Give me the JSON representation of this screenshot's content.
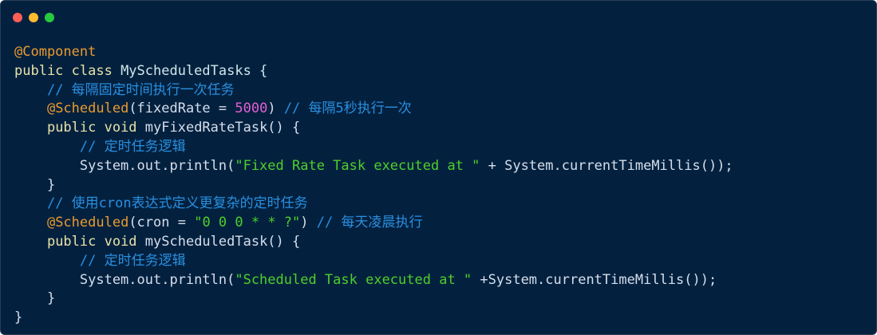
{
  "window": {
    "buttons": {
      "close_color": "#ff5f57",
      "minimize_color": "#febc2e",
      "zoom_color": "#28c840"
    }
  },
  "code": {
    "language": "java",
    "lines": [
      [
        {
          "t": "@Component",
          "k": "ann"
        }
      ],
      [
        {
          "t": "public class ",
          "k": "kw"
        },
        {
          "t": "MyScheduledTasks {",
          "k": "cls"
        }
      ],
      [
        {
          "t": "    ",
          "k": "pl"
        },
        {
          "t": "// 每隔固定时间执行一次任务",
          "k": "cm"
        }
      ],
      [
        {
          "t": "    ",
          "k": "pl"
        },
        {
          "t": "@Scheduled",
          "k": "ann"
        },
        {
          "t": "(fixedRate = ",
          "k": "pl"
        },
        {
          "t": "5000",
          "k": "num"
        },
        {
          "t": ") ",
          "k": "pl"
        },
        {
          "t": "// 每隔5秒执行一次",
          "k": "cm"
        }
      ],
      [
        {
          "t": "    ",
          "k": "pl"
        },
        {
          "t": "public void ",
          "k": "kw"
        },
        {
          "t": "myFixedRateTask() {",
          "k": "pl"
        }
      ],
      [
        {
          "t": "        ",
          "k": "pl"
        },
        {
          "t": "// 定时任务逻辑",
          "k": "cm"
        }
      ],
      [
        {
          "t": "        System.out.println(",
          "k": "pl"
        },
        {
          "t": "\"Fixed Rate Task executed at \"",
          "k": "str"
        },
        {
          "t": " + System.currentTimeMillis());",
          "k": "pl"
        }
      ],
      [
        {
          "t": "    }",
          "k": "pl"
        }
      ],
      [
        {
          "t": "    ",
          "k": "pl"
        },
        {
          "t": "// 使用cron表达式定义更复杂的定时任务",
          "k": "cm"
        }
      ],
      [
        {
          "t": "    ",
          "k": "pl"
        },
        {
          "t": "@Scheduled",
          "k": "ann"
        },
        {
          "t": "(cron = ",
          "k": "pl"
        },
        {
          "t": "\"0 0 0 * * ?\"",
          "k": "str"
        },
        {
          "t": ") ",
          "k": "pl"
        },
        {
          "t": "// 每天凌晨执行",
          "k": "cm"
        }
      ],
      [
        {
          "t": "    ",
          "k": "pl"
        },
        {
          "t": "public void ",
          "k": "kw"
        },
        {
          "t": "myScheduledTask() {",
          "k": "pl"
        }
      ],
      [
        {
          "t": "        ",
          "k": "pl"
        },
        {
          "t": "// 定时任务逻辑",
          "k": "cm"
        }
      ],
      [
        {
          "t": "        System.out.println(",
          "k": "pl"
        },
        {
          "t": "\"Scheduled Task executed at \"",
          "k": "str"
        },
        {
          "t": " +System.currentTimeMillis());",
          "k": "pl"
        }
      ],
      [
        {
          "t": "    }",
          "k": "pl"
        }
      ],
      [
        {
          "t": "}",
          "k": "pl"
        }
      ]
    ]
  }
}
